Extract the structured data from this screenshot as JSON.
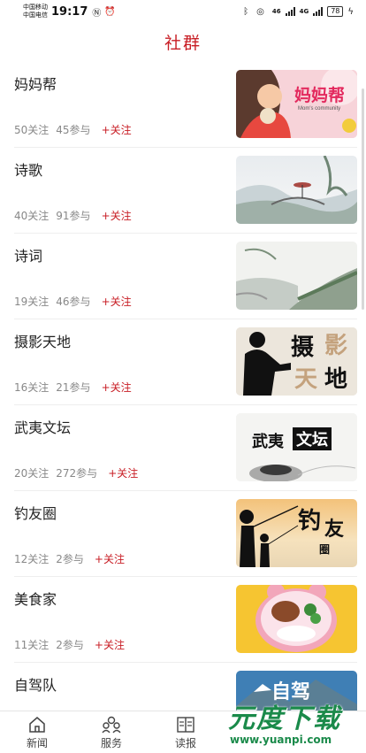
{
  "status_bar": {
    "carrier1": "中国移动",
    "carrier2": "中国电信",
    "time": "19:17",
    "signal_label_1": "46",
    "signal_label_2": "4G",
    "battery": "78"
  },
  "header": {
    "title": "社群"
  },
  "groups": [
    {
      "name": "妈妈帮",
      "follows": "50关注",
      "participants": "45参与",
      "follow_label": "+关注",
      "thumb_text": "妈妈帮",
      "thumb_sub": "Mom's community"
    },
    {
      "name": "诗歌",
      "follows": "40关注",
      "participants": "91参与",
      "follow_label": "+关注"
    },
    {
      "name": "诗词",
      "follows": "19关注",
      "participants": "46参与",
      "follow_label": "+关注"
    },
    {
      "name": "摄影天地",
      "follows": "16关注",
      "participants": "21参与",
      "follow_label": "+关注",
      "thumb_text_1": "摄",
      "thumb_text_2": "影",
      "thumb_text_3": "天",
      "thumb_text_4": "地"
    },
    {
      "name": "武夷文坛",
      "follows": "20关注",
      "participants": "272参与",
      "follow_label": "+关注",
      "thumb_text_a": "武夷",
      "thumb_text_b": "文坛"
    },
    {
      "name": "钓友圈",
      "follows": "12关注",
      "participants": "2参与",
      "follow_label": "+关注",
      "thumb_text_1": "钓",
      "thumb_text_2": "友",
      "thumb_text_3": "圈"
    },
    {
      "name": "美食家",
      "follows": "11关注",
      "participants": "2参与",
      "follow_label": "+关注"
    },
    {
      "name": "自驾队",
      "thumb_text": "自驾"
    }
  ],
  "bottom_nav": [
    {
      "label": "新闻",
      "icon": "home-icon"
    },
    {
      "label": "服务",
      "icon": "people-icon"
    },
    {
      "label": "读报",
      "icon": "newspaper-icon"
    }
  ],
  "watermark": {
    "title": "元度下载",
    "url": "www.yuanpi.com"
  },
  "colors": {
    "accent": "#c81d24",
    "stat_text": "#888888",
    "watermark": "#1a8a4a"
  }
}
